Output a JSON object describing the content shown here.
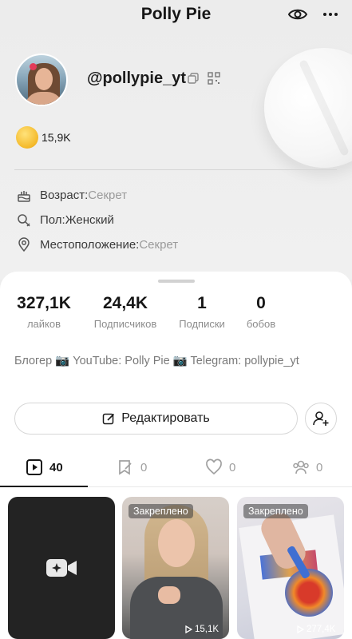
{
  "header": {
    "title": "Polly Pie"
  },
  "profile": {
    "username": "@pollypie_yt",
    "coins": "15,9K"
  },
  "info": {
    "age_label": "Возраст:",
    "age_value": "Секрет",
    "gender_label": "Пол:",
    "gender_value": "Женский",
    "location_label": "Местоположение:",
    "location_value": "Секрет"
  },
  "stats": [
    {
      "value": "327,1K",
      "label": "лайков"
    },
    {
      "value": "24,4K",
      "label": "Подписчиков"
    },
    {
      "value": "1",
      "label": "Подписки"
    },
    {
      "value": "0",
      "label": "бобов"
    }
  ],
  "bio": "Блогер 📷 YouTube: Polly Pie 📷 Telegram: pollypie_yt",
  "actions": {
    "edit_label": "Редактировать"
  },
  "tabs": [
    {
      "icon": "video-play-icon",
      "count": "40"
    },
    {
      "icon": "bookmark-edit-icon",
      "count": "0"
    },
    {
      "icon": "heart-icon",
      "count": "0"
    },
    {
      "icon": "friends-icon",
      "count": "0"
    }
  ],
  "videos": [
    {
      "type": "upload",
      "icon": "video-camera-icon"
    },
    {
      "pinned_label": "Закреплено",
      "views": "15,1K"
    },
    {
      "pinned_label": "Закреплено",
      "views": "277,4K"
    }
  ],
  "colors": {
    "accent_text": "#161616",
    "muted_text": "#9a9a9a",
    "sheet_bg": "#ffffff",
    "page_bg": "#ededed"
  }
}
